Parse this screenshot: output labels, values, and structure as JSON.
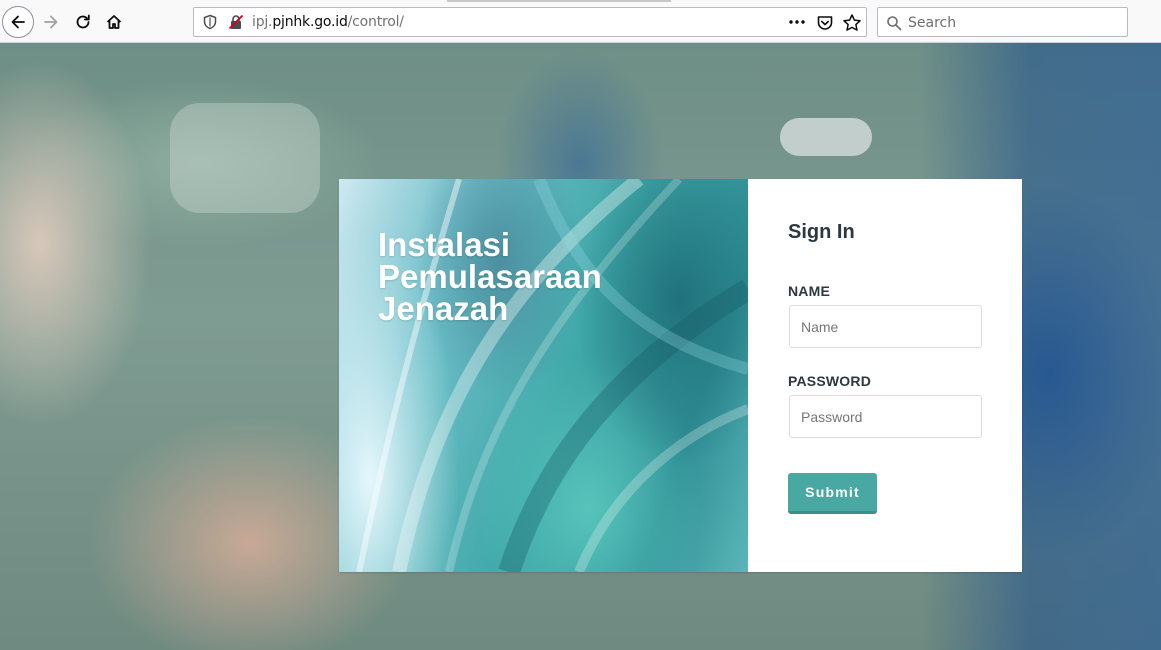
{
  "browser": {
    "url_prefix": "ipj.",
    "url_domain": "pjnhk.go.id",
    "url_path": "/control/",
    "search_placeholder": "Search",
    "icons": [
      "back-arrow-icon",
      "forward-arrow-icon",
      "reload-icon",
      "home-icon",
      "tracking-shield-icon",
      "insecure-lock-icon",
      "more-icon",
      "pocket-icon",
      "bookmark-star-icon",
      "search-icon"
    ]
  },
  "hero": {
    "title": "Instalasi Pemulasaraan Jenazah"
  },
  "login": {
    "heading": "Sign In",
    "name_label": "NAME",
    "name_placeholder": "Name",
    "name_value": "",
    "password_label": "PASSWORD",
    "password_placeholder": "Password",
    "password_value": "",
    "submit_label": "Submit"
  },
  "colors": {
    "accent": "#4aa8a2",
    "heading_text": "#2c3840",
    "hero_text": "#ffffff"
  }
}
